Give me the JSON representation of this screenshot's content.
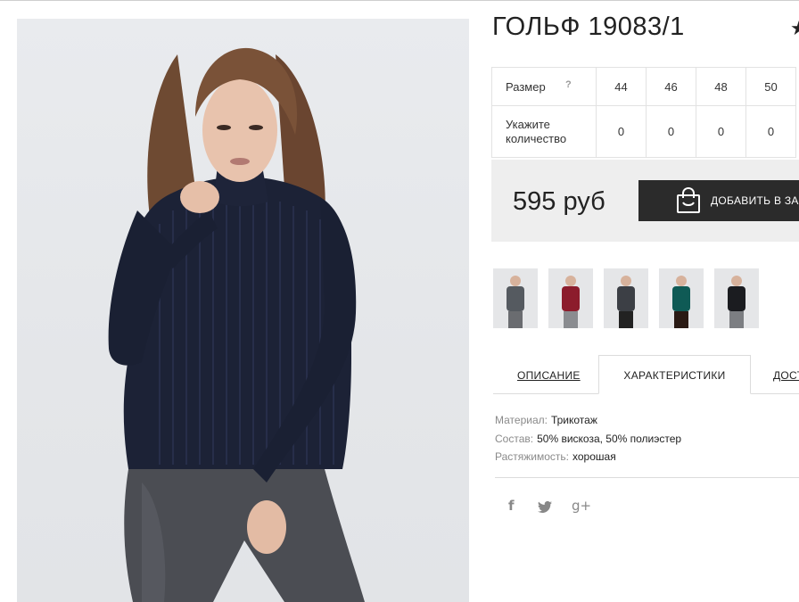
{
  "product": {
    "title": "ГОЛЬФ 19083/1",
    "favorite_icon": "star-icon"
  },
  "sizes": {
    "size_label": "Размер",
    "help_mark": "?",
    "quantity_label_line1": "Укажите",
    "quantity_label_line2": "количество",
    "columns": [
      {
        "size": "44",
        "qty": "0"
      },
      {
        "size": "46",
        "qty": "0"
      },
      {
        "size": "48",
        "qty": "0"
      },
      {
        "size": "50",
        "qty": "0"
      }
    ]
  },
  "purchase": {
    "price": "595 руб",
    "cart_button_label": "ДОБАВИТЬ В ЗА",
    "cart_icon": "shopping-bag-icon"
  },
  "thumbnails": [
    {
      "color": "#555a60"
    },
    {
      "color": "#8c1c2c"
    },
    {
      "color": "#3c3f45"
    },
    {
      "color": "#0f5a55"
    },
    {
      "color": "#1b1c20"
    }
  ],
  "tabs": {
    "description": "ОПИСАНИЕ",
    "characteristics": "ХАРАКТЕРИСТИКИ",
    "delivery": "ДОСТ"
  },
  "characteristics": [
    {
      "key": "Материал:",
      "value": "Трикотаж"
    },
    {
      "key": "Состав:",
      "value": "50% вискоза, 50% полиэстер"
    },
    {
      "key": "Растяжимость:",
      "value": "хорошая"
    }
  ],
  "social": {
    "facebook": "f",
    "twitter": "twitter-icon",
    "google_plus": "g+"
  },
  "colors": {
    "button_dark": "#2b2b2b",
    "price_box_bg": "#eeeeee",
    "sweater_navy": "#1c2236"
  }
}
